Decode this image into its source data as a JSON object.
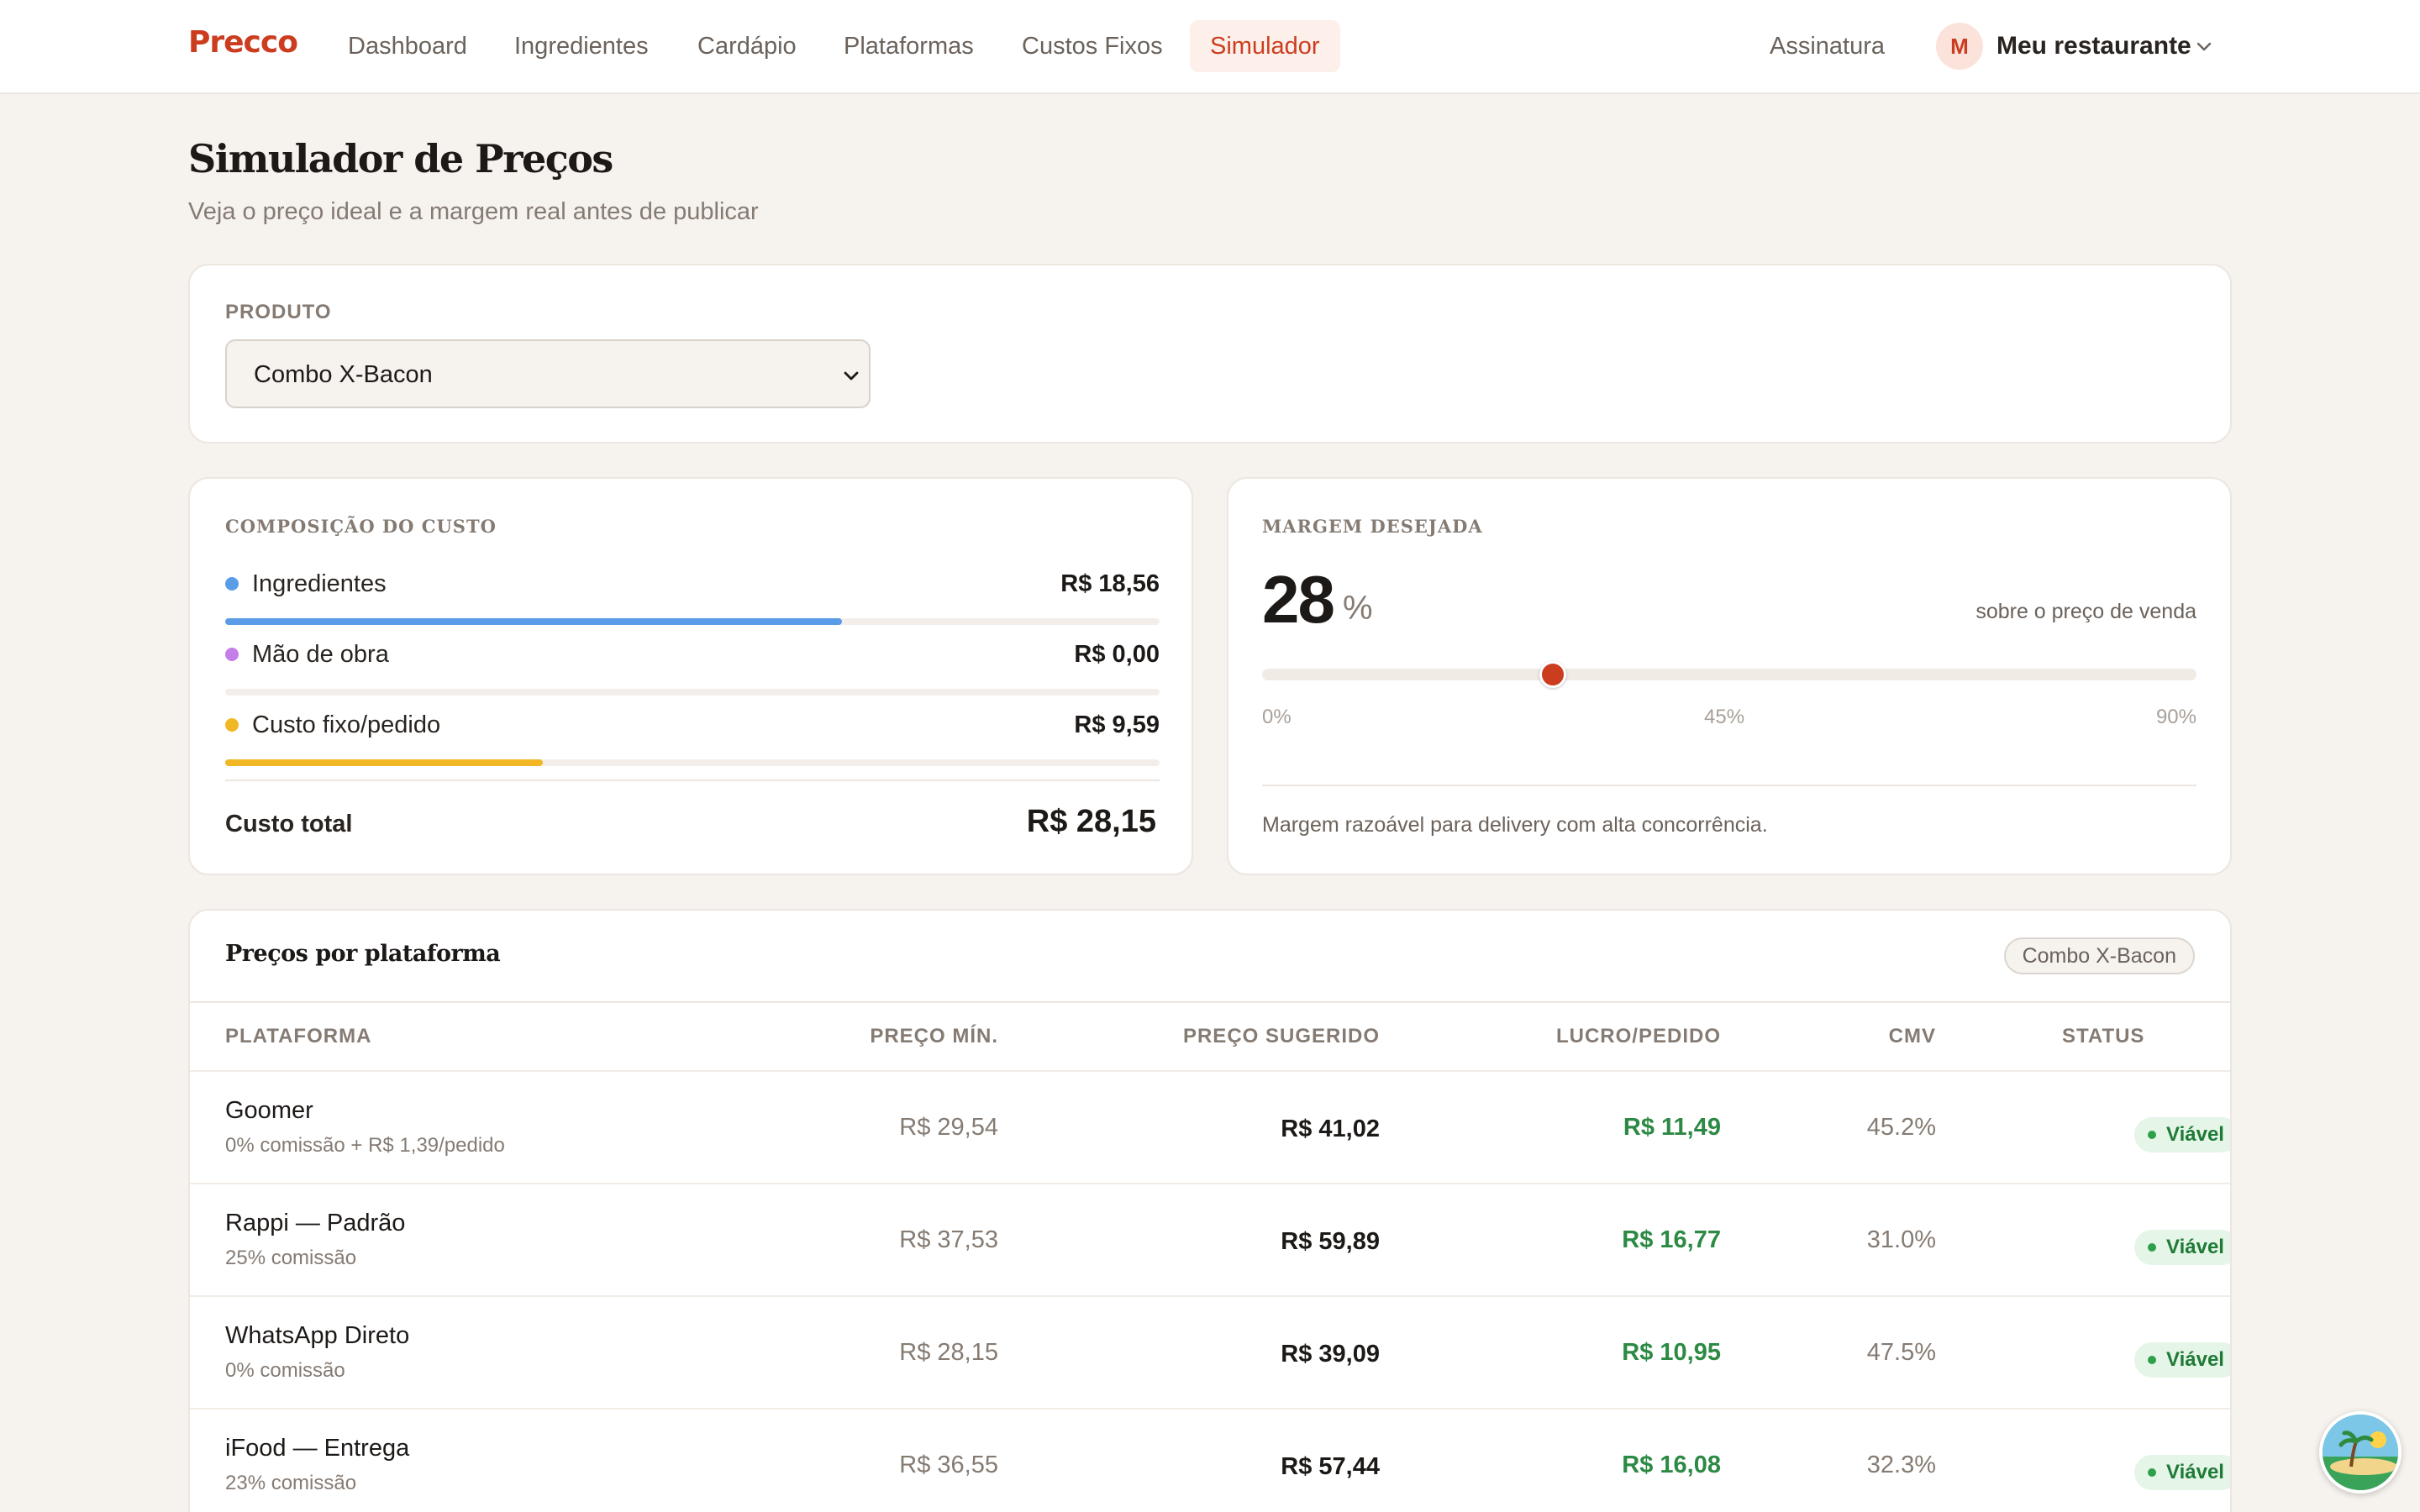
{
  "nav": {
    "brand": "Precco",
    "links": [
      "Dashboard",
      "Ingredientes",
      "Cardápio",
      "Plataformas",
      "Custos Fixos",
      "Simulador"
    ],
    "active": "Simulador",
    "subscription": "Assinatura",
    "avatar_initial": "M",
    "restaurant": "Meu restaurante"
  },
  "header": {
    "title": "Simulador de Preços",
    "subtitle": "Veja o preço ideal e a margem real antes de publicar"
  },
  "product": {
    "label": "PRODUTO",
    "selected": "Combo X-Bacon"
  },
  "cost": {
    "label": "COMPOSIÇÃO DO CUSTO",
    "items": [
      {
        "label": "Ingredientes",
        "value": "R$ 18,56",
        "share": 0.66,
        "color": "#5b9ce8"
      },
      {
        "label": "Mão de obra",
        "value": "R$ 0,00",
        "share": 0.0,
        "color": "#c47ee8"
      },
      {
        "label": "Custo fixo/pedido",
        "value": "R$ 9,59",
        "share": 0.34,
        "color": "#f2b724"
      }
    ],
    "total_label": "Custo total",
    "total_value": "R$ 28,15"
  },
  "margin": {
    "label": "MARGEM DESEJADA",
    "value": "28",
    "unit": "%",
    "note": "sobre o preço de venda",
    "slider_value": 28,
    "slider_min": 0,
    "slider_max": 90,
    "ticks": [
      "0%",
      "45%",
      "90%"
    ],
    "hint": "Margem razoável para delivery com alta concorrência."
  },
  "platforms": {
    "title": "Preços por plataforma",
    "tag": "Combo X-Bacon",
    "headers": [
      "PLATAFORMA",
      "PREÇO MÍN.",
      "PREÇO SUGERIDO",
      "LUCRO/PEDIDO",
      "CMV",
      "STATUS"
    ],
    "rows": [
      {
        "name": "Goomer",
        "sub": "0% comissão + R$ 1,39/pedido",
        "min": "R$ 29,54",
        "suggested": "R$ 41,02",
        "profit": "R$ 11,49",
        "cmv": "45.2%",
        "status": "Viável"
      },
      {
        "name": "Rappi — Padrão",
        "sub": "25% comissão",
        "min": "R$ 37,53",
        "suggested": "R$ 59,89",
        "profit": "R$ 16,77",
        "cmv": "31.0%",
        "status": "Viável"
      },
      {
        "name": "WhatsApp Direto",
        "sub": "0% comissão",
        "min": "R$ 28,15",
        "suggested": "R$ 39,09",
        "profit": "R$ 10,95",
        "cmv": "47.5%",
        "status": "Viável"
      },
      {
        "name": "iFood — Entrega",
        "sub": "23% comissão",
        "min": "R$ 36,55",
        "suggested": "R$ 57,44",
        "profit": "R$ 16,08",
        "cmv": "32.3%",
        "status": "Viável"
      }
    ]
  },
  "colors": {
    "accent": "#cc3d20",
    "positive": "#2c8a44",
    "background": "#f6f2ee"
  }
}
